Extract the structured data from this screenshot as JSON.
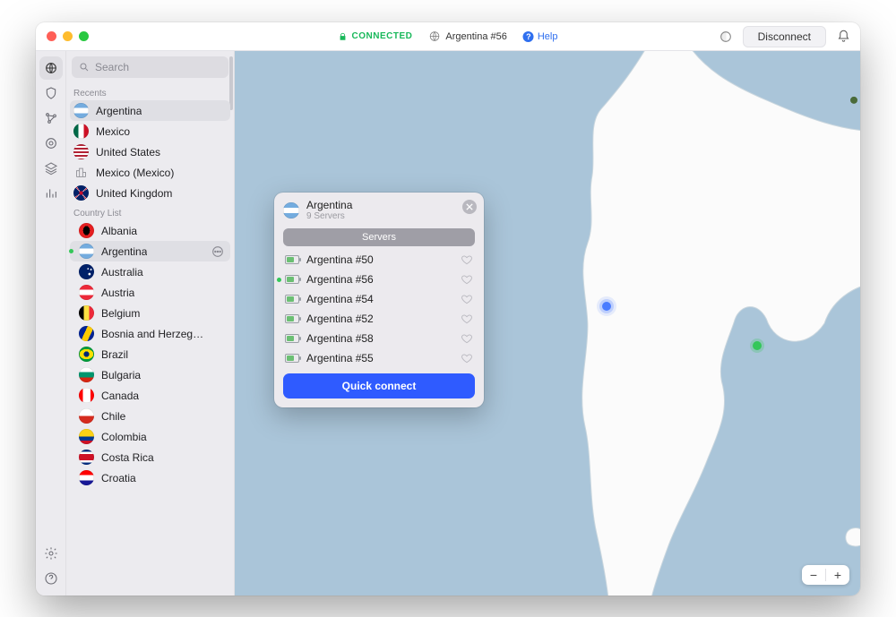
{
  "titlebar": {
    "status_label": "CONNECTED",
    "server_label": "Argentina #56",
    "help_label": "Help",
    "disconnect_label": "Disconnect"
  },
  "search": {
    "placeholder": "Search"
  },
  "sections": {
    "recents_label": "Recents",
    "country_list_label": "Country List"
  },
  "recents": [
    {
      "label": "Argentina",
      "flag": "flag-ar",
      "selected": true
    },
    {
      "label": "Mexico",
      "flag": "flag-mx"
    },
    {
      "label": "United States",
      "flag": "flag-us"
    },
    {
      "label": "Mexico (Mexico)",
      "city": true
    },
    {
      "label": "United Kingdom",
      "flag": "flag-gb"
    }
  ],
  "countries": [
    {
      "label": "Albania",
      "flag": "flag-al"
    },
    {
      "label": "Argentina",
      "flag": "flag-ar",
      "selected": true,
      "connected": true,
      "more": true
    },
    {
      "label": "Australia",
      "flag": "flag-au"
    },
    {
      "label": "Austria",
      "flag": "flag-at"
    },
    {
      "label": "Belgium",
      "flag": "flag-be"
    },
    {
      "label": "Bosnia and Herzeg…",
      "flag": "flag-ba"
    },
    {
      "label": "Brazil",
      "flag": "flag-br"
    },
    {
      "label": "Bulgaria",
      "flag": "flag-bg"
    },
    {
      "label": "Canada",
      "flag": "flag-ca"
    },
    {
      "label": "Chile",
      "flag": "flag-cl"
    },
    {
      "label": "Colombia",
      "flag": "flag-co"
    },
    {
      "label": "Costa Rica",
      "flag": "flag-cr"
    },
    {
      "label": "Croatia",
      "flag": "flag-hr"
    }
  ],
  "popover": {
    "title": "Argentina",
    "subtitle": "9 Servers",
    "tab": "Servers",
    "quick_connect": "Quick connect",
    "servers": [
      {
        "label": "Argentina #50"
      },
      {
        "label": "Argentina #56",
        "connected": true
      },
      {
        "label": "Argentina #54"
      },
      {
        "label": "Argentina #52"
      },
      {
        "label": "Argentina #58"
      },
      {
        "label": "Argentina #55"
      }
    ]
  },
  "zoom": {
    "minus": "−",
    "plus": "+"
  }
}
